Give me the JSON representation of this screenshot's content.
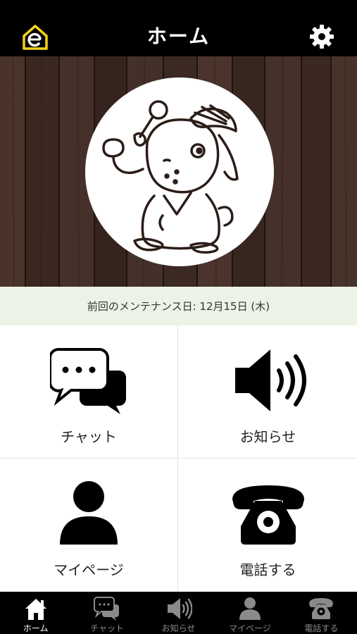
{
  "header": {
    "title": "ホーム",
    "logo_icon": "home-e-logo-icon",
    "settings_icon": "gear-icon",
    "logo_color": "#f2d21b"
  },
  "hero": {
    "background": "wood-planks",
    "image": "detective-mascot-with-pipe-and-magnifier"
  },
  "maintenance": {
    "text": "前回のメンテナンス日: 12月15日 (木)"
  },
  "tiles": [
    {
      "label": "チャット",
      "icon": "chat-bubbles-icon"
    },
    {
      "label": "お知らせ",
      "icon": "speaker-icon"
    },
    {
      "label": "マイページ",
      "icon": "person-icon"
    },
    {
      "label": "電話する",
      "icon": "telephone-icon"
    }
  ],
  "tabbar": {
    "active_index": 0,
    "items": [
      {
        "label": "ホーム",
        "icon": "home-icon"
      },
      {
        "label": "チャット",
        "icon": "chat-bubbles-icon"
      },
      {
        "label": "お知らせ",
        "icon": "speaker-icon"
      },
      {
        "label": "マイページ",
        "icon": "person-icon"
      },
      {
        "label": "電話する",
        "icon": "telephone-icon"
      }
    ]
  },
  "colors": {
    "header_bg": "#000000",
    "maintenance_bg": "#eaf3e6",
    "tab_inactive": "#8a8a8a",
    "tab_active": "#ffffff"
  }
}
